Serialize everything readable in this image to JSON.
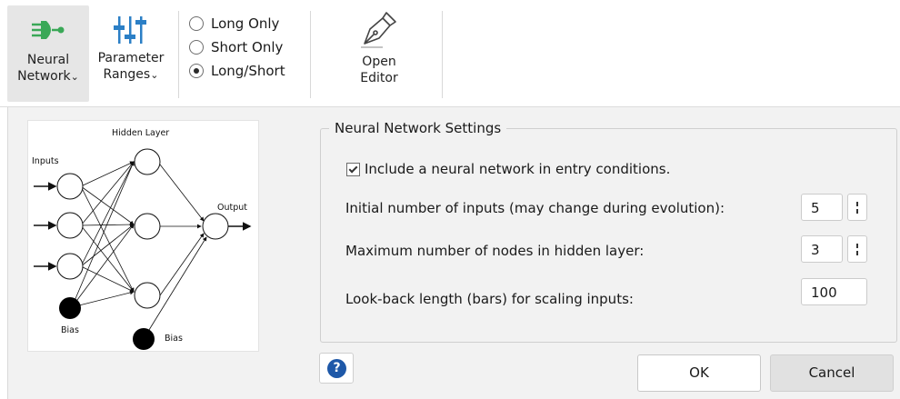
{
  "ribbon": {
    "neural_network": {
      "line1": "Neural",
      "line2": "Network",
      "icon": "neural-network-icon",
      "color": "#3aa857"
    },
    "parameter_ranges": {
      "line1": "Parameter",
      "line2": "Ranges",
      "icon": "sliders-icon",
      "color": "#2b7fc6"
    },
    "trade_direction": {
      "options": [
        "Long Only",
        "Short Only",
        "Long/Short"
      ],
      "selected": "Long/Short"
    },
    "open_editor": {
      "line1": "Open",
      "line2": "Editor",
      "icon": "pen-nib-icon"
    }
  },
  "diagram": {
    "hidden_layer": "Hidden Layer",
    "inputs": "Inputs",
    "output": "Output",
    "bias_input": "Bias",
    "bias_hidden": "Bias"
  },
  "settings": {
    "group_title": "Neural Network Settings",
    "include_nn": {
      "label": "Include a neural network in entry conditions.",
      "checked": true
    },
    "initial_inputs": {
      "label": "Initial number of inputs (may change during evolution):",
      "value": "5"
    },
    "max_nodes": {
      "label": "Maximum number of nodes in hidden layer:",
      "value": "3"
    },
    "lookback": {
      "label": "Look-back length (bars) for scaling inputs:",
      "value": "100"
    }
  },
  "dialog": {
    "help": "?",
    "ok_label": "OK",
    "cancel_label": "Cancel",
    "help_color": "#1e58a8"
  }
}
